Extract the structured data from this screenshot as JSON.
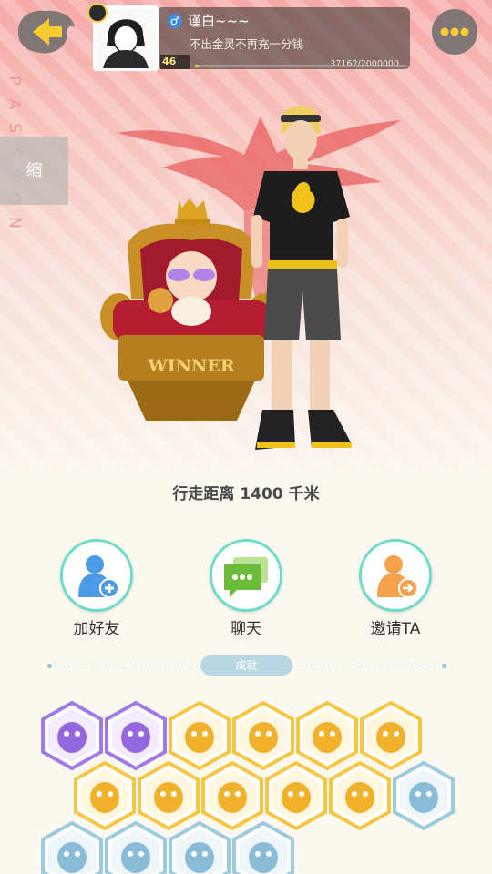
{
  "header": {
    "nickname": "谨白~~~",
    "signature": "不出金灵不再充一分钱",
    "level": "46",
    "exp_text": "37162/2000000",
    "exp_progress": 0.019,
    "gender": "♂"
  },
  "side_text": [
    "P",
    "A",
    "S",
    "S",
    "I",
    "O",
    "N"
  ],
  "collapse_label": "缩",
  "scene": {
    "throne_text": "WINNER"
  },
  "distance_text": "行走距离 1400 千米",
  "actions": [
    {
      "label": "加好友"
    },
    {
      "label": "聊天"
    },
    {
      "label": "邀请TA"
    }
  ],
  "achievements_label": "成就",
  "colors": {
    "accent_teal": "#6fdcca",
    "purple": "#a07ae6",
    "gold": "#f6c744",
    "blue": "#8fc3dc"
  },
  "achievements": [
    {
      "icon": "demon-face-icon",
      "tier": "purple"
    },
    {
      "icon": "orb-icon",
      "tier": "purple"
    },
    {
      "icon": "stairs-icon",
      "tier": "gold"
    },
    {
      "icon": "trophy-icon",
      "tier": "gold"
    },
    {
      "icon": "egg-icon",
      "tier": "gold"
    },
    {
      "icon": "coin-icon",
      "tier": "gold"
    },
    {
      "icon": "cart-icon",
      "tier": "gold"
    },
    {
      "icon": "bear-icon",
      "tier": "gold"
    },
    {
      "icon": "book-icon",
      "tier": "gold"
    },
    {
      "icon": "mermaid-icon",
      "tier": "gold"
    },
    {
      "icon": "cat-book-icon",
      "tier": "gold"
    },
    {
      "icon": "moon-icon",
      "tier": "blue"
    },
    {
      "icon": "spirit-icon",
      "tier": "blue"
    },
    {
      "icon": "scroll-icon",
      "tier": "blue"
    },
    {
      "icon": "monster-icon",
      "tier": "blue"
    },
    {
      "icon": "cat-icon",
      "tier": "blue"
    }
  ]
}
